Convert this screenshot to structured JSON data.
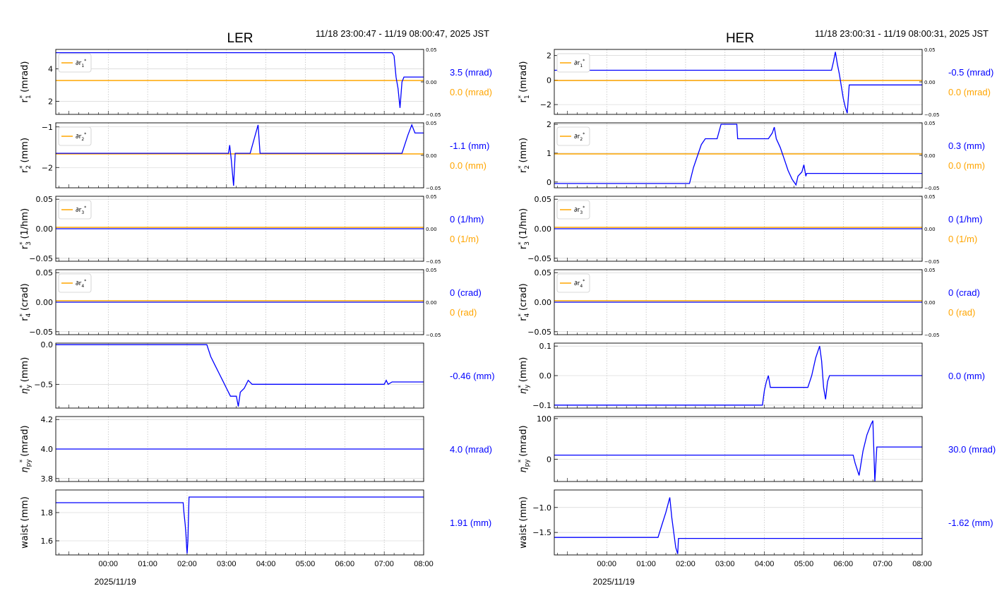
{
  "colors": {
    "main": "#0000ff",
    "ref": "#ffa500",
    "grid": "#b0b0b0",
    "axis": "#000000"
  },
  "date_label": "2025/11/19",
  "time_ticks": [
    "00:00",
    "01:00",
    "02:00",
    "03:00",
    "04:00",
    "05:00",
    "06:00",
    "07:00",
    "08:00"
  ],
  "chart_data": [
    {
      "type": "line",
      "title": "LER",
      "subtitle": "11/18 23:00:47 - 11/19 08:00:47, 2025 JST",
      "x_range": [
        "2025-11-18 23:00:47",
        "2025-11-19 08:00:47"
      ],
      "panels": [
        {
          "ylabel": "r1*",
          "ylabel_unit": "(mrad)",
          "ylim": [
            1.2,
            5.2
          ],
          "yticks": [
            "2",
            "4"
          ],
          "yticks_values": [
            2,
            4
          ],
          "right_ylim": [
            -0.05,
            0.05
          ],
          "right_ticks": [
            "0.05",
            "0.00",
            "−0.05"
          ],
          "legend": "∂r1*",
          "readout": "3.5 (mrad)",
          "ref_readout": "0.0 (mrad)",
          "ref_value": 0.0,
          "series": [
            [
              -1.33,
              5
            ],
            [
              7.2,
              5
            ],
            [
              7.25,
              4.8
            ],
            [
              7.3,
              3.5
            ],
            [
              7.35,
              2.8
            ],
            [
              7.4,
              1.6
            ],
            [
              7.45,
              3.2
            ],
            [
              7.5,
              3.5
            ],
            [
              8.0,
              3.5
            ]
          ]
        },
        {
          "ylabel": "r2*",
          "ylabel_unit": "(mm)",
          "ylim": [
            -2.5,
            -0.9
          ],
          "yticks": [
            "−2",
            "−1"
          ],
          "yticks_values": [
            -2,
            -1
          ],
          "right_ylim": [
            -0.05,
            0.05
          ],
          "right_ticks": [
            "0.05",
            "0.00",
            "−0.05"
          ],
          "legend": "∂r2*",
          "readout": "-1.1 (mm)",
          "ref_readout": "0.0 (mm)",
          "ref_value": 0.0,
          "series": [
            [
              -1.33,
              -1.65
            ],
            [
              3.05,
              -1.65
            ],
            [
              3.08,
              -1.45
            ],
            [
              3.12,
              -1.8
            ],
            [
              3.18,
              -2.45
            ],
            [
              3.22,
              -1.65
            ],
            [
              3.6,
              -1.65
            ],
            [
              3.7,
              -1.3
            ],
            [
              3.8,
              -0.95
            ],
            [
              3.85,
              -1.65
            ],
            [
              7.45,
              -1.65
            ],
            [
              7.6,
              -1.2
            ],
            [
              7.7,
              -0.95
            ],
            [
              7.78,
              -1.15
            ],
            [
              8.0,
              -1.15
            ]
          ]
        },
        {
          "ylabel": "r3*",
          "ylabel_unit": "(1/hm)",
          "ylim": [
            -0.055,
            0.055
          ],
          "yticks": [
            "−0.05",
            "0.00",
            "0.05"
          ],
          "yticks_values": [
            -0.05,
            0,
            0.05
          ],
          "right_ylim": [
            -0.05,
            0.05
          ],
          "right_ticks": [
            "0.05",
            "0.00",
            "−0.05"
          ],
          "legend": "∂r3*",
          "readout": "0 (1/hm)",
          "ref_readout": "0 (1/m)",
          "ref_value": 0.0,
          "series": [
            [
              -1.33,
              0
            ],
            [
              8.0,
              0
            ]
          ]
        },
        {
          "ylabel": "r4*",
          "ylabel_unit": "(crad)",
          "ylim": [
            -0.055,
            0.055
          ],
          "yticks": [
            "−0.05",
            "0.00",
            "0.05"
          ],
          "yticks_values": [
            -0.05,
            0,
            0.05
          ],
          "right_ylim": [
            -0.05,
            0.05
          ],
          "right_ticks": [
            "0.05",
            "0.00",
            "−0.05"
          ],
          "legend": "∂r4*",
          "readout": "0 (crad)",
          "ref_readout": "0 (rad)",
          "ref_value": 0.0,
          "series": [
            [
              -1.33,
              0
            ],
            [
              8.0,
              0
            ]
          ]
        },
        {
          "ylabel": "ηy*",
          "ylabel_unit": "(mm)",
          "ylim": [
            -0.8,
            0.02
          ],
          "yticks": [
            "−0.5",
            "0.0"
          ],
          "yticks_values": [
            -0.5,
            0
          ],
          "readout": "-0.46 (mm)",
          "series": [
            [
              -1.33,
              0
            ],
            [
              2.5,
              0
            ],
            [
              2.6,
              -0.15
            ],
            [
              2.7,
              -0.25
            ],
            [
              2.8,
              -0.35
            ],
            [
              2.9,
              -0.45
            ],
            [
              3.0,
              -0.55
            ],
            [
              3.05,
              -0.6
            ],
            [
              3.1,
              -0.65
            ],
            [
              3.25,
              -0.65
            ],
            [
              3.3,
              -0.78
            ],
            [
              3.35,
              -0.6
            ],
            [
              3.45,
              -0.55
            ],
            [
              3.55,
              -0.45
            ],
            [
              3.65,
              -0.5
            ],
            [
              3.7,
              -0.5
            ],
            [
              7.0,
              -0.5
            ],
            [
              7.05,
              -0.45
            ],
            [
              7.1,
              -0.5
            ],
            [
              7.2,
              -0.47
            ],
            [
              8.0,
              -0.47
            ]
          ]
        },
        {
          "ylabel": "ηpy*",
          "ylabel_unit": "(mrad)",
          "ylim": [
            3.78,
            4.22
          ],
          "yticks": [
            "3.8",
            "4.0",
            "4.2"
          ],
          "yticks_values": [
            3.8,
            4.0,
            4.2
          ],
          "readout": "4.0 (mrad)",
          "series": [
            [
              -1.33,
              4.0
            ],
            [
              8.0,
              4.0
            ]
          ]
        },
        {
          "ylabel": "waist",
          "ylabel_unit": "(mm)",
          "ylim": [
            1.5,
            1.96
          ],
          "yticks": [
            "1.6",
            "1.8"
          ],
          "yticks_values": [
            1.6,
            1.8
          ],
          "readout": "1.91 (mm)",
          "series": [
            [
              -1.33,
              1.87
            ],
            [
              1.9,
              1.87
            ],
            [
              1.92,
              1.8
            ],
            [
              1.95,
              1.72
            ],
            [
              1.97,
              1.65
            ],
            [
              1.99,
              1.55
            ],
            [
              2.0,
              1.51
            ],
            [
              2.02,
              1.6
            ],
            [
              2.05,
              1.91
            ],
            [
              8.0,
              1.91
            ]
          ]
        }
      ]
    },
    {
      "type": "line",
      "title": "HER",
      "subtitle": "11/18 23:00:31 - 11/19 08:00:31, 2025 JST",
      "x_range": [
        "2025-11-18 23:00:31",
        "2025-11-19 08:00:31"
      ],
      "panels": [
        {
          "ylabel": "r1*",
          "ylabel_unit": "(mrad)",
          "ylim": [
            -2.8,
            2.5
          ],
          "yticks": [
            "−2",
            "0",
            "2"
          ],
          "yticks_values": [
            -2,
            0,
            2
          ],
          "right_ylim": [
            -0.05,
            0.05
          ],
          "right_ticks": [
            "0.05",
            "0.00",
            "−0.05"
          ],
          "legend": "∂r1*",
          "readout": "-0.5 (mrad)",
          "ref_readout": "0.0 (mrad)",
          "ref_value": 0.0,
          "series": [
            [
              -1.33,
              0.8
            ],
            [
              5.7,
              0.8
            ],
            [
              5.75,
              1.5
            ],
            [
              5.8,
              2.3
            ],
            [
              5.85,
              1.3
            ],
            [
              5.9,
              0.5
            ],
            [
              5.95,
              -0.5
            ],
            [
              6.0,
              -1.5
            ],
            [
              6.05,
              -2.2
            ],
            [
              6.1,
              -2.7
            ],
            [
              6.15,
              -0.4
            ],
            [
              8.0,
              -0.4
            ]
          ]
        },
        {
          "ylabel": "r2*",
          "ylabel_unit": "(mm)",
          "ylim": [
            -0.2,
            2.05
          ],
          "yticks": [
            "0",
            "1",
            "2"
          ],
          "yticks_values": [
            0,
            1,
            2
          ],
          "right_ylim": [
            -0.05,
            0.05
          ],
          "right_ticks": [
            "0.05",
            "0.00",
            "−0.05"
          ],
          "legend": "∂r2*",
          "readout": "0.3 (mm)",
          "ref_readout": "0.0 (mm)",
          "ref_value": 0.0,
          "series": [
            [
              -1.33,
              -0.05
            ],
            [
              2.1,
              -0.05
            ],
            [
              2.2,
              0.5
            ],
            [
              2.3,
              0.9
            ],
            [
              2.4,
              1.3
            ],
            [
              2.5,
              1.5
            ],
            [
              2.8,
              1.5
            ],
            [
              2.9,
              2.0
            ],
            [
              3.3,
              2.0
            ],
            [
              3.32,
              1.5
            ],
            [
              4.1,
              1.5
            ],
            [
              4.2,
              1.7
            ],
            [
              4.25,
              1.9
            ],
            [
              4.3,
              1.5
            ],
            [
              4.4,
              1.2
            ],
            [
              4.5,
              0.8
            ],
            [
              4.6,
              0.4
            ],
            [
              4.7,
              0.1
            ],
            [
              4.8,
              -0.1
            ],
            [
              4.85,
              0.2
            ],
            [
              4.95,
              0.35
            ],
            [
              5.0,
              0.6
            ],
            [
              5.05,
              0.2
            ],
            [
              5.07,
              0.3
            ],
            [
              8.0,
              0.3
            ]
          ]
        },
        {
          "ylabel": "r3*",
          "ylabel_unit": "(1/hm)",
          "ylim": [
            -0.055,
            0.055
          ],
          "yticks": [
            "−0.05",
            "0.00",
            "0.05"
          ],
          "yticks_values": [
            -0.05,
            0,
            0.05
          ],
          "right_ylim": [
            -0.05,
            0.05
          ],
          "right_ticks": [
            "0.05",
            "0.00",
            "−0.05"
          ],
          "legend": "∂r3*",
          "readout": "0 (1/hm)",
          "ref_readout": "0 (1/m)",
          "ref_value": 0.0,
          "series": [
            [
              -1.33,
              0
            ],
            [
              8.0,
              0
            ]
          ]
        },
        {
          "ylabel": "r4*",
          "ylabel_unit": "(crad)",
          "ylim": [
            -0.055,
            0.055
          ],
          "yticks": [
            "−0.05",
            "0.00",
            "0.05"
          ],
          "yticks_values": [
            -0.05,
            0,
            0.05
          ],
          "right_ylim": [
            -0.05,
            0.05
          ],
          "right_ticks": [
            "0.05",
            "0.00",
            "−0.05"
          ],
          "legend": "∂r4*",
          "readout": "0 (crad)",
          "ref_readout": "0 (rad)",
          "ref_value": 0.0,
          "series": [
            [
              -1.33,
              0
            ],
            [
              8.0,
              0
            ]
          ]
        },
        {
          "ylabel": "ηy*",
          "ylabel_unit": "(mm)",
          "ylim": [
            -0.11,
            0.11
          ],
          "yticks": [
            "−0.1",
            "0.0",
            "0.1"
          ],
          "yticks_values": [
            -0.1,
            0,
            0.1
          ],
          "readout": "0.0 (mm)",
          "series": [
            [
              -1.33,
              -0.1
            ],
            [
              3.95,
              -0.1
            ],
            [
              4.0,
              -0.05
            ],
            [
              4.05,
              -0.02
            ],
            [
              4.1,
              0.0
            ],
            [
              4.15,
              -0.04
            ],
            [
              5.1,
              -0.04
            ],
            [
              5.2,
              0.0
            ],
            [
              5.3,
              0.06
            ],
            [
              5.4,
              0.1
            ],
            [
              5.45,
              0.05
            ],
            [
              5.5,
              -0.04
            ],
            [
              5.55,
              -0.08
            ],
            [
              5.6,
              -0.02
            ],
            [
              5.65,
              0.0
            ],
            [
              8.0,
              0.0
            ]
          ]
        },
        {
          "ylabel": "ηpy*",
          "ylabel_unit": "(mrad)",
          "ylim": [
            -55,
            105
          ],
          "yticks": [
            "0",
            "100"
          ],
          "yticks_values": [
            0,
            100
          ],
          "readout": "30.0 (mrad)",
          "series": [
            [
              -1.33,
              10
            ],
            [
              6.25,
              10
            ],
            [
              6.3,
              -10
            ],
            [
              6.4,
              -40
            ],
            [
              6.5,
              20
            ],
            [
              6.6,
              60
            ],
            [
              6.7,
              85
            ],
            [
              6.75,
              95
            ],
            [
              6.8,
              -55
            ],
            [
              6.85,
              30
            ],
            [
              8.0,
              30
            ]
          ]
        },
        {
          "ylabel": "waist",
          "ylabel_unit": "(mm)",
          "ylim": [
            -1.95,
            -0.65
          ],
          "yticks": [
            "−1.5",
            "−1.0"
          ],
          "yticks_values": [
            -1.5,
            -1.0
          ],
          "readout": "-1.62 (mm)",
          "series": [
            [
              -1.33,
              -1.6
            ],
            [
              1.3,
              -1.6
            ],
            [
              1.4,
              -1.35
            ],
            [
              1.5,
              -1.1
            ],
            [
              1.6,
              -0.8
            ],
            [
              1.65,
              -1.2
            ],
            [
              1.7,
              -1.5
            ],
            [
              1.75,
              -1.8
            ],
            [
              1.8,
              -1.93
            ],
            [
              1.82,
              -1.62
            ],
            [
              8.0,
              -1.62
            ]
          ]
        }
      ]
    }
  ]
}
